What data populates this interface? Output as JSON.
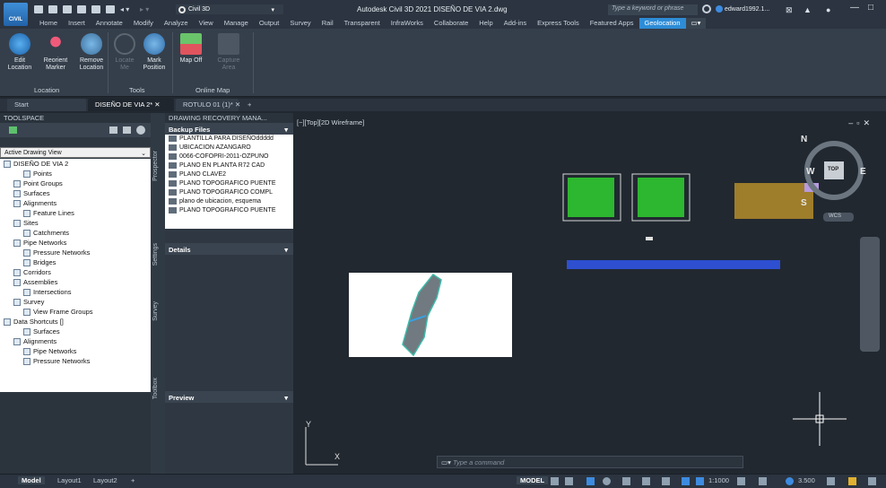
{
  "app": {
    "logo_text": "CIVIL",
    "workspace": "Civil 3D",
    "title": "Autodesk Civil 3D 2021   DISEÑO DE VIA 2.dwg",
    "search_placeholder": "Type a keyword or phrase",
    "user": "edward1992.1...",
    "accent": "#2e8cd6"
  },
  "ribbon_tabs": [
    "Home",
    "Insert",
    "Annotate",
    "Modify",
    "Analyze",
    "View",
    "Manage",
    "Output",
    "Survey",
    "Rail",
    "Transparent",
    "InfraWorks",
    "Collaborate",
    "Help",
    "Add-ins",
    "Express Tools",
    "Featured Apps",
    "Geolocation"
  ],
  "ribbon_active": "Geolocation",
  "ribbon": {
    "edit_location": "Edit Location",
    "reorient_marker": "Reorient Marker",
    "remove_location": "Remove Location",
    "locate_me": "Locate Me",
    "mark_position": "Mark Position",
    "map_off": "Map Off",
    "capture_area": "Capture Area",
    "panel_location": "Location",
    "panel_tools": "Tools",
    "panel_online_map": "Online Map"
  },
  "doc_tabs": [
    "Start",
    "DISEÑO DE VIA 2*",
    "ROTULO 01 (1)*"
  ],
  "toolspace": {
    "title": "TOOLSPACE",
    "view": "Active Drawing View",
    "tree": [
      {
        "label": "DISEÑO DE VIA 2",
        "indent": 0
      },
      {
        "label": "Points",
        "indent": 2
      },
      {
        "label": "Point Groups",
        "indent": 1
      },
      {
        "label": "Surfaces",
        "indent": 1
      },
      {
        "label": "Alignments",
        "indent": 1
      },
      {
        "label": "Feature Lines",
        "indent": 2
      },
      {
        "label": "Sites",
        "indent": 1
      },
      {
        "label": "Catchments",
        "indent": 2
      },
      {
        "label": "Pipe Networks",
        "indent": 1
      },
      {
        "label": "Pressure Networks",
        "indent": 2
      },
      {
        "label": "Bridges",
        "indent": 2
      },
      {
        "label": "Corridors",
        "indent": 1
      },
      {
        "label": "Assemblies",
        "indent": 1
      },
      {
        "label": "Intersections",
        "indent": 2
      },
      {
        "label": "Survey",
        "indent": 1
      },
      {
        "label": "View Frame Groups",
        "indent": 2
      },
      {
        "label": "Data Shortcuts []",
        "indent": 0
      },
      {
        "label": "Surfaces",
        "indent": 2
      },
      {
        "label": "Alignments",
        "indent": 1
      },
      {
        "label": "Pipe Networks",
        "indent": 2
      },
      {
        "label": "Pressure Networks",
        "indent": 2
      }
    ],
    "vtabs": [
      "Prospector",
      "Settings",
      "Survey",
      "Toolbox"
    ]
  },
  "recovery": {
    "title": "DRAWING RECOVERY MANA...",
    "backup_files": "Backup Files",
    "files": [
      "PLANTILLA PARA DISEÑOddddd",
      "UBICACION AZANGARO",
      "0066-COFOPRI-2011-OZPUNO",
      "PLANO EN PLANTA R72 CAD",
      "PLANO CLAVE2",
      "PLANO TOPOGRAFICO PUENTE",
      "PLANO TOPOGRAFICO COMPL",
      "plano de ubicacion, esquema",
      "PLANO TOPOGRAFICO PUENTE"
    ],
    "details": "Details",
    "preview": "Preview"
  },
  "viewport": {
    "label": "[−][Top][2D Wireframe]",
    "compass_n": "N",
    "compass_s": "S",
    "compass_e": "E",
    "compass_w": "W",
    "compass_top": "TOP",
    "wcs": "WCS",
    "ucs_x": "X",
    "ucs_y": "Y",
    "command_placeholder": "Type a command"
  },
  "status": {
    "tabs": [
      "Model",
      "Layout1",
      "Layout2"
    ],
    "model": "MODEL",
    "scale": "1:1000",
    "value": "3.500"
  }
}
